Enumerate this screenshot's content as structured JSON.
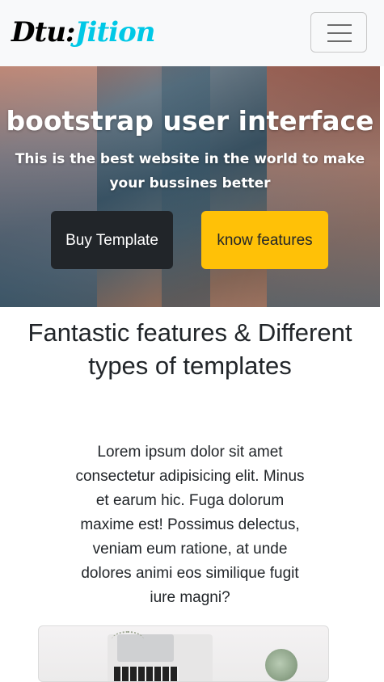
{
  "navbar": {
    "brand_part1": "Dtu:",
    "brand_part2": "Jition",
    "toggler_icon": "hamburger-menu-icon",
    "brand_accent_color": "#00c8e6"
  },
  "hero": {
    "title": "bootstrap user interface",
    "subtitle": "This is the best website in the world to make your bussines better",
    "buy_button": "Buy Template",
    "features_button": "know features",
    "dark_button_color": "#212529",
    "warning_button_color": "#ffc107"
  },
  "features": {
    "heading": "Fantastic features & Different types of templates",
    "body": "Lorem ipsum dolor sit amet consectetur adipisicing elit. Minus et earum hic. Fuga dolorum maxime est! Possimus delectus, veniam eum ratione, at unde dolores animi eos similique fugit iure magni?"
  }
}
